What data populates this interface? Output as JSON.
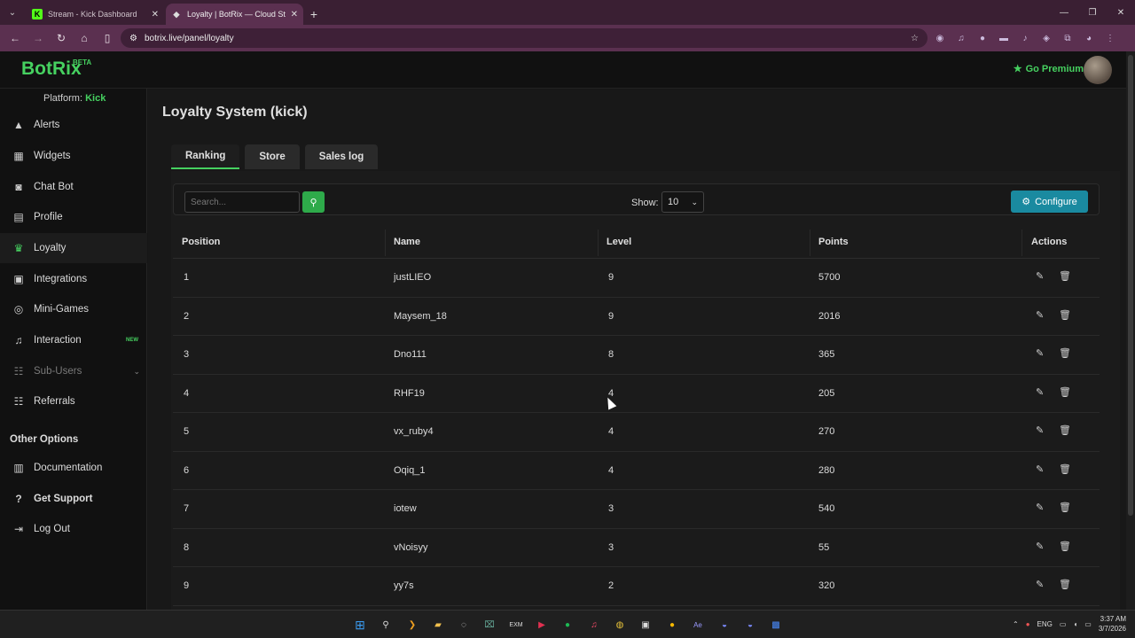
{
  "browser": {
    "tabs": [
      {
        "title": "Stream - Kick Dashboard",
        "favicon": "K",
        "active": false
      },
      {
        "title": "Loyalty | BotRix — Cloud Stream",
        "favicon": "◆",
        "active": true
      }
    ],
    "url": "botrix.live/panel/loyalty"
  },
  "header": {
    "logo": "BotRix",
    "logo_badge": "BETA",
    "premium_label": "Go Premium",
    "accent": "#46d160"
  },
  "sidebar": {
    "platform_label": "Platform:",
    "platform_value": "Kick",
    "items": [
      {
        "label": "Alerts",
        "icon": "warning-icon"
      },
      {
        "label": "Widgets",
        "icon": "grid-icon"
      },
      {
        "label": "Chat Bot",
        "icon": "robot-icon"
      },
      {
        "label": "Profile",
        "icon": "id-card-icon"
      },
      {
        "label": "Loyalty",
        "icon": "trophy-icon"
      },
      {
        "label": "Integrations",
        "icon": "cube-icon"
      },
      {
        "label": "Mini-Games",
        "icon": "gamepad-icon"
      },
      {
        "label": "Interaction",
        "icon": "music-icon",
        "badge": "NEW"
      },
      {
        "label": "Sub-Users",
        "icon": "users-icon"
      },
      {
        "label": "Referrals",
        "icon": "users-icon"
      }
    ],
    "other_heading": "Other Options",
    "other_items": [
      {
        "label": "Documentation",
        "icon": "book-icon"
      },
      {
        "label": "Get Support",
        "icon": "question-icon"
      },
      {
        "label": "Log Out",
        "icon": "logout-icon"
      }
    ]
  },
  "main": {
    "title": "Loyalty System (kick)",
    "tabs": [
      "Ranking",
      "Store",
      "Sales log"
    ],
    "search_placeholder": "Search...",
    "show_label": "Show:",
    "show_value": "10",
    "configure_label": "Configure",
    "columns": [
      "Position",
      "Name",
      "Level",
      "Points",
      "Actions"
    ],
    "rows": [
      {
        "position": "1",
        "name": "justLIEO",
        "level": "9",
        "points": "5700"
      },
      {
        "position": "2",
        "name": "Maysem_18",
        "level": "9",
        "points": "2016"
      },
      {
        "position": "3",
        "name": "Dno111",
        "level": "8",
        "points": "365"
      },
      {
        "position": "4",
        "name": "RHF19",
        "level": "4",
        "points": "205"
      },
      {
        "position": "5",
        "name": "vx_ruby4",
        "level": "4",
        "points": "270"
      },
      {
        "position": "6",
        "name": "Oqiq_1",
        "level": "4",
        "points": "280"
      },
      {
        "position": "7",
        "name": "iotew",
        "level": "3",
        "points": "540"
      },
      {
        "position": "8",
        "name": "vNoisyy",
        "level": "3",
        "points": "55"
      },
      {
        "position": "9",
        "name": "yy7s",
        "level": "2",
        "points": "320"
      }
    ]
  },
  "taskbar": {
    "lang": "ENG",
    "time": "3:37 AM",
    "date": "3/7/2026"
  }
}
